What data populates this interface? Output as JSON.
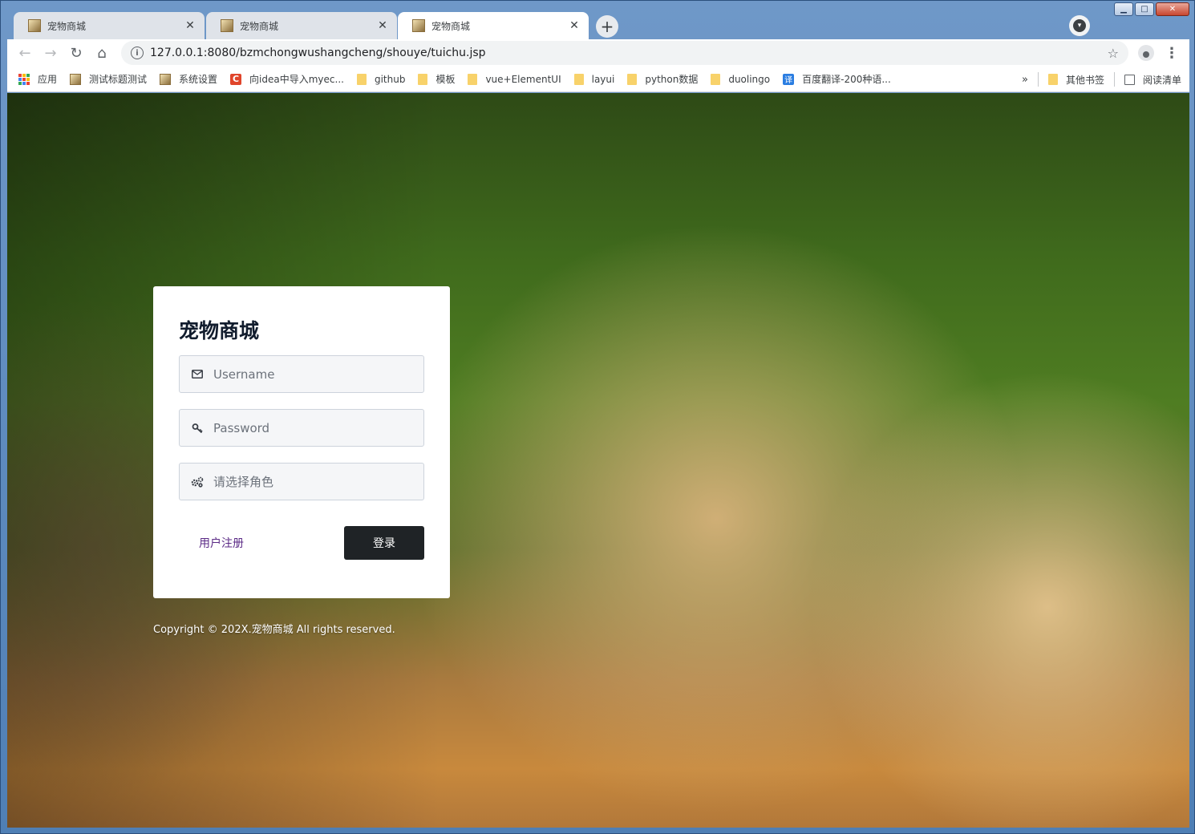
{
  "window": {
    "controls": {
      "minimize": "▁",
      "maximize": "□",
      "close": "✕"
    }
  },
  "tabs": [
    {
      "title": "宠物商城",
      "close": "✕",
      "active": false
    },
    {
      "title": "宠物商城",
      "close": "✕",
      "active": false
    },
    {
      "title": "宠物商城",
      "close": "✕",
      "active": true
    }
  ],
  "new_tab_label": "+",
  "toolbar": {
    "back": "←",
    "forward": "→",
    "reload": "↻",
    "home": "⌂",
    "info": "i",
    "url": "127.0.0.1:8080/bzmchongwushangcheng/shouye/tuichu.jsp",
    "star": "☆",
    "menu": "⋮"
  },
  "bookmarks": {
    "items": [
      {
        "label": "应用",
        "icon": "apps-icon"
      },
      {
        "label": "测试标题测试",
        "icon": "page-icon"
      },
      {
        "label": "系统设置",
        "icon": "page-icon"
      },
      {
        "label": "向idea中导入myec...",
        "icon": "c-logo-icon"
      },
      {
        "label": "github",
        "icon": "folder-icon"
      },
      {
        "label": "模板",
        "icon": "folder-icon"
      },
      {
        "label": "vue+ElementUI",
        "icon": "folder-icon"
      },
      {
        "label": "layui",
        "icon": "folder-icon"
      },
      {
        "label": "python数据",
        "icon": "folder-icon"
      },
      {
        "label": "duolingo",
        "icon": "folder-icon"
      },
      {
        "label": "百度翻译-200种语...",
        "icon": "translate-icon"
      }
    ],
    "overflow": "»",
    "other": "其他书签",
    "reading_list": "阅读清单",
    "translate_glyph": "译",
    "c_glyph": "C"
  },
  "login": {
    "title": "宠物商城",
    "username_placeholder": "Username",
    "password_placeholder": "Password",
    "role_placeholder": "请选择角色",
    "register_link": "用户注册",
    "login_button": "登录"
  },
  "footer": {
    "copyright": "Copyright © 202X.宠物商城 All rights reserved."
  },
  "colors": {
    "card_bg": "#ffffff",
    "login_button_bg": "#1f2326",
    "register_link": "#5b2a86",
    "title": "#111c2d"
  }
}
